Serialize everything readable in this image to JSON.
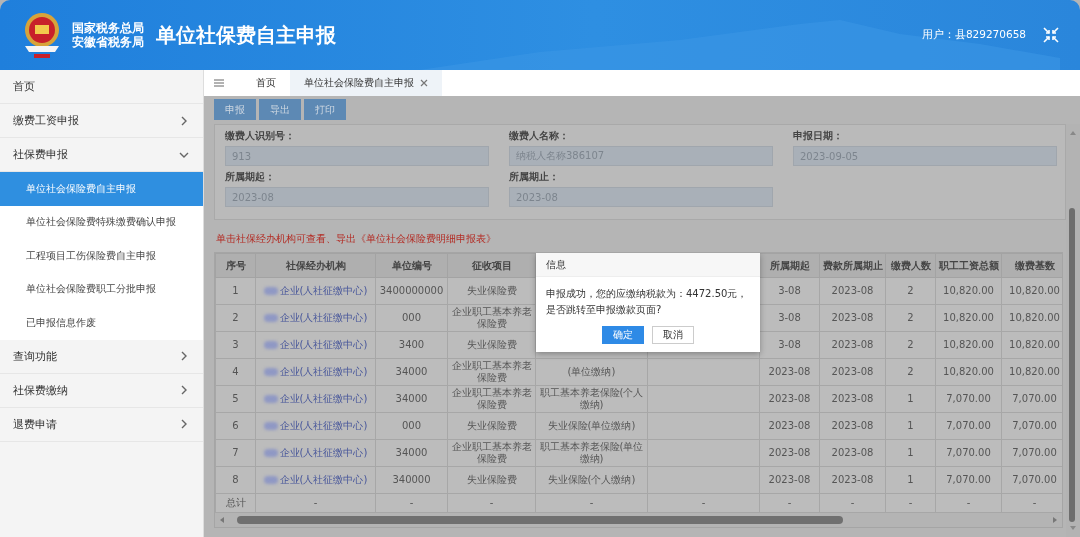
{
  "header": {
    "org_lines": [
      "国家税务总局",
      "安徽省税务局"
    ],
    "title": "单位社保费自主申报",
    "user": "用户：县829270658"
  },
  "sidebar": {
    "items": [
      {
        "label": "首页",
        "kind": "link"
      },
      {
        "label": "缴费工资申报",
        "kind": "group",
        "expanded": false
      },
      {
        "label": "社保费申报",
        "kind": "group",
        "expanded": true,
        "children": [
          {
            "label": "单位社会保险费自主申报",
            "selected": true
          },
          {
            "label": "单位社会保险费特殊缴费确认申报",
            "selected": false
          },
          {
            "label": "工程项目工伤保险费自主申报",
            "selected": false
          },
          {
            "label": "单位社会保险费职工分批申报",
            "selected": false
          },
          {
            "label": "已申报信息作废",
            "selected": false
          }
        ]
      },
      {
        "label": "查询功能",
        "kind": "group",
        "expanded": false
      },
      {
        "label": "社保费缴纳",
        "kind": "group",
        "expanded": false
      },
      {
        "label": "退费申请",
        "kind": "group",
        "expanded": false
      }
    ]
  },
  "tabs": [
    {
      "label": "首页",
      "selected": false,
      "closable": false
    },
    {
      "label": "单位社会保险费自主申报",
      "selected": true,
      "closable": true
    }
  ],
  "toolbar": [
    "申报",
    "导出",
    "打印"
  ],
  "form": {
    "fields": [
      {
        "label": "缴费人识别号：",
        "value": "913"
      },
      {
        "label": "缴费人名称：",
        "value": "纳税人名称386107"
      },
      {
        "label": "申报日期：",
        "value": "2023-09-05"
      },
      {
        "label": "所属期起：",
        "value": "2023-08"
      },
      {
        "label": "所属期止：",
        "value": "2023-08"
      }
    ]
  },
  "note": "单击社保经办机构可查看、导出《单位社会保险费明细申报表》",
  "table": {
    "columns": [
      {
        "header": "序号",
        "kind": "index"
      },
      {
        "header": "社保经办机构",
        "kind": "link"
      },
      {
        "header": "单位编号",
        "kind": "text"
      },
      {
        "header": "征收项目",
        "kind": "text"
      },
      {
        "kind": "text"
      },
      {
        "kind": "text"
      },
      {
        "header": "所属期起",
        "kind": "text"
      },
      {
        "header": "费款所属期止",
        "kind": "text"
      },
      {
        "header": "缴费人数",
        "kind": "text"
      },
      {
        "header": "职工工资总额",
        "kind": "number"
      },
      {
        "header": "缴费基数",
        "kind": "number"
      }
    ],
    "rows": [
      [
        "1",
        "企业(人社征缴中心)",
        "3400000000",
        "失业保险费",
        null,
        null,
        "3-08",
        "2023-08",
        "2",
        "10,820.00",
        "10,820.00"
      ],
      [
        "2",
        "企业(人社征缴中心)",
        "000",
        "企业职工基本养老保险费",
        null,
        null,
        "3-08",
        "2023-08",
        "2",
        "10,820.00",
        "10,820.00"
      ],
      [
        "3",
        "企业(人社征缴中心)",
        "3400",
        "失业保险费",
        null,
        null,
        "3-08",
        "2023-08",
        "2",
        "10,820.00",
        "10,820.00"
      ],
      [
        "4",
        "企业(人社征缴中心)",
        "34000",
        "企业职工基本养老保险费",
        "(单位缴纳)",
        null,
        "2023-08",
        "2023-08",
        "2",
        "10,820.00",
        "10,820.00"
      ],
      [
        "5",
        "企业(人社征缴中心)",
        "34000",
        "企业职工基本养老保险费",
        "职工基本养老保险(个人缴纳)",
        null,
        "2023-08",
        "2023-08",
        "1",
        "7,070.00",
        "7,070.00"
      ],
      [
        "6",
        "企业(人社征缴中心)",
        "000",
        "失业保险费",
        "失业保险(单位缴纳)",
        null,
        "2023-08",
        "2023-08",
        "1",
        "7,070.00",
        "7,070.00"
      ],
      [
        "7",
        "企业(人社征缴中心)",
        "34000",
        "企业职工基本养老保险费",
        "职工基本养老保险(单位缴纳)",
        null,
        "2023-08",
        "2023-08",
        "1",
        "7,070.00",
        "7,070.00"
      ],
      [
        "8",
        "企业(人社征缴中心)",
        "340000",
        "失业保险费",
        "失业保险(个人缴纳)",
        null,
        "2023-08",
        "2023-08",
        "1",
        "7,070.00",
        "7,070.00"
      ]
    ],
    "total": [
      "总计",
      "-",
      "-",
      "-",
      "-",
      "-",
      "-",
      "-",
      "-",
      "-",
      "-"
    ]
  },
  "dialog": {
    "title": "信息",
    "message": "申报成功，您的应缴纳税款为：4472.50元，是否跳转至申报缴款页面?",
    "buttons": [
      {
        "label": "确定",
        "kind": "primary"
      },
      {
        "label": "取消",
        "kind": "secondary"
      }
    ]
  }
}
